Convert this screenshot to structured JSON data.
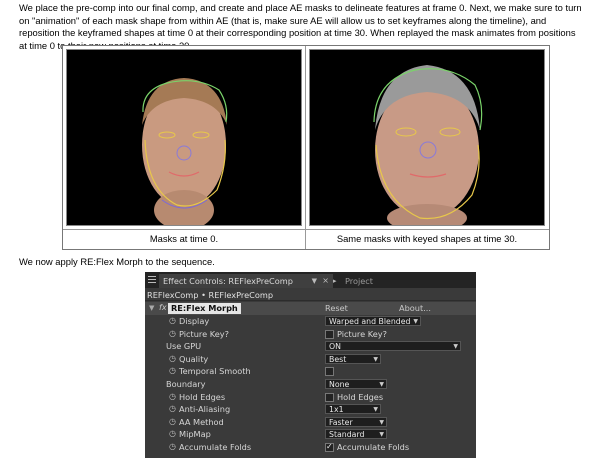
{
  "intro_text": "We place the pre-comp into our final comp, and create and place AE masks to delineate features at frame 0. Next, we make sure to turn on \"animation\" of each mask shape from within AE (that is, make sure AE will allow us to set keyframes along the timeline), and reposition the keyframed shapes at time 0 at their corresponding position at time 30. When replayed the mask animates from positions at time 0 to their new positions at time 30.",
  "figure": {
    "left_caption": "Masks at time 0.",
    "right_caption": "Same masks with keyed shapes at time 30."
  },
  "apply_text": "We now apply RE:Flex Morph to the sequence.",
  "panel": {
    "active_tab": "Effect Controls: REFlexPreComp",
    "inactive_tab": "Project",
    "comp_line": "REFlexComp • REFlexPreComp",
    "effect_name": "RE:Flex Morph",
    "reset_label": "Reset",
    "about_label": "About...",
    "rows": [
      {
        "label": "Display",
        "control": "dropdown",
        "value": "Warped and Blended"
      },
      {
        "label": "Picture Key?",
        "control": "checkbox",
        "checked": false,
        "cb_label": "Picture Key?"
      },
      {
        "label": "Use GPU",
        "control": "dropdown",
        "value": "ON"
      },
      {
        "label": "Quality",
        "control": "dropdown",
        "value": "Best"
      },
      {
        "label": "Temporal Smooth",
        "control": "checkbox",
        "checked": false,
        "cb_label": ""
      },
      {
        "label": "Boundary",
        "control": "dropdown",
        "value": "None"
      },
      {
        "label": "Hold Edges",
        "control": "checkbox",
        "checked": false,
        "cb_label": "Hold Edges"
      },
      {
        "label": "Anti-Aliasing",
        "control": "dropdown",
        "value": "1x1"
      },
      {
        "label": "AA Method",
        "control": "dropdown",
        "value": "Faster"
      },
      {
        "label": "MipMap",
        "control": "dropdown",
        "value": "Standard"
      },
      {
        "label": "Accumulate Folds",
        "control": "checkbox",
        "checked": true,
        "cb_label": "Accumulate Folds"
      }
    ]
  }
}
